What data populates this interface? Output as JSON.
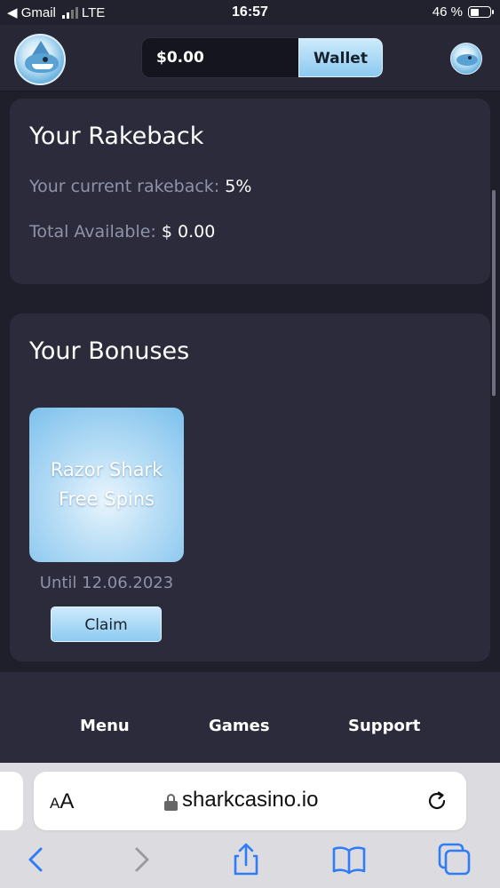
{
  "status_bar": {
    "back_app": "◀ Gmail",
    "network": "LTE",
    "time": "16:57",
    "battery": "46 %",
    "battery_level": 0.46
  },
  "header": {
    "balance": "$0.00",
    "wallet_label": "Wallet"
  },
  "rakeback": {
    "title": "Your Rakeback",
    "current_label": "Your current rakeback:",
    "current_value": "5%",
    "available_label": "Total Available:",
    "available_value": "$ 0.00"
  },
  "bonuses": {
    "title": "Your Bonuses",
    "items": [
      {
        "name_line1": "Razor Shark",
        "name_line2": "Free Spins",
        "until": "Until 12.06.2023",
        "claim_label": "Claim"
      }
    ]
  },
  "bottom_nav": {
    "menu": "Menu",
    "games": "Games",
    "support": "Support"
  },
  "browser": {
    "text_size_small": "A",
    "text_size_big": "A",
    "url": "sharkcasino.io"
  },
  "colors": {
    "background": "#1f1f2b",
    "card": "#2b2b3b",
    "accent_light_blue": "#8ccaf0",
    "muted_text": "#8f93a8"
  }
}
